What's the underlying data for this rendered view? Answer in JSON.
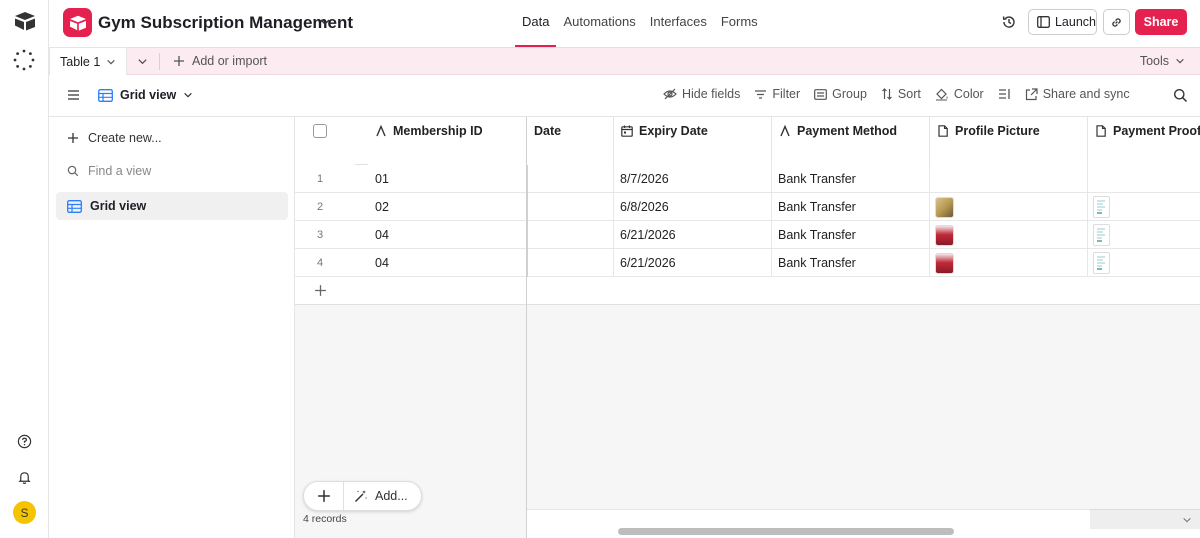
{
  "app": {
    "base_title": "Gym Subscription Management",
    "nav_tabs": [
      {
        "label": "Data",
        "active": true
      },
      {
        "label": "Automations",
        "active": false
      },
      {
        "label": "Interfaces",
        "active": false
      },
      {
        "label": "Forms",
        "active": false
      }
    ],
    "launch_label": "Launch",
    "share_label": "Share",
    "accent_color": "#e5214f"
  },
  "table_bar": {
    "table_tab": "Table 1",
    "add_import": "Add or import",
    "tools": "Tools"
  },
  "view_bar": {
    "view_name": "Grid view",
    "actions": {
      "hide_fields": "Hide fields",
      "filter": "Filter",
      "group": "Group",
      "sort": "Sort",
      "color": "Color",
      "share_sync": "Share and sync"
    }
  },
  "views_panel": {
    "create_new": "Create new...",
    "find_placeholder": "Find a view",
    "items": [
      {
        "label": "Grid view",
        "selected": true
      }
    ]
  },
  "grid": {
    "columns": {
      "membership_id": "Membership ID",
      "date": "Date",
      "expiry_date": "Expiry Date",
      "payment_method": "Payment Method",
      "profile_picture": "Profile Picture",
      "payment_proof": "Payment Proof"
    },
    "rows": [
      {
        "num": "1",
        "membership_id": "01",
        "expiry_date": "8/7/2026",
        "payment_method": "Bank Transfer",
        "has_picture": false,
        "picture_style": "",
        "has_proof": false
      },
      {
        "num": "2",
        "membership_id": "02",
        "expiry_date": "6/8/2026",
        "payment_method": "Bank Transfer",
        "has_picture": true,
        "picture_style": "beige",
        "has_proof": true
      },
      {
        "num": "3",
        "membership_id": "04",
        "expiry_date": "6/21/2026",
        "payment_method": "Bank Transfer",
        "has_picture": true,
        "picture_style": "red",
        "has_proof": true
      },
      {
        "num": "4",
        "membership_id": "04",
        "expiry_date": "6/21/2026",
        "payment_method": "Bank Transfer",
        "has_picture": true,
        "picture_style": "red",
        "has_proof": true
      }
    ],
    "add_label": "Add...",
    "records_count": "4 records"
  },
  "user": {
    "avatar_initial": "S",
    "avatar_color": "#f5c400"
  }
}
